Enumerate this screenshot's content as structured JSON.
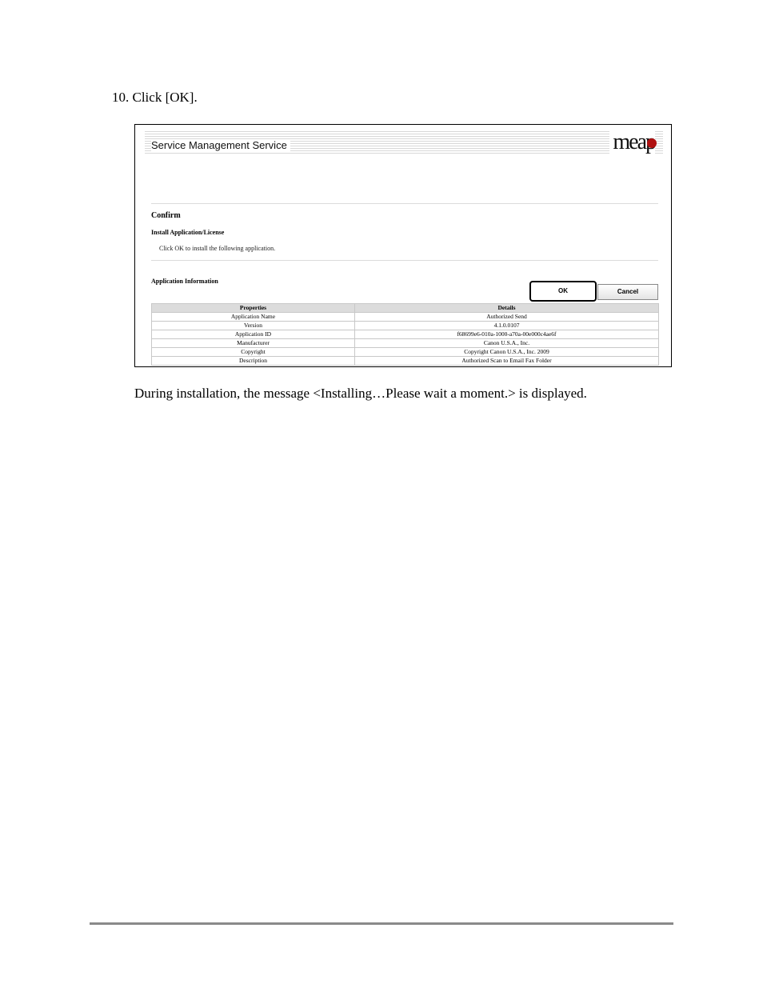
{
  "step": "10. Click [OK].",
  "window": {
    "title": "Service Management Service",
    "logo": "meap",
    "section_title": "Confirm",
    "subsection_title": "Install Application/License",
    "instruction": "Click OK to install the following application.",
    "info_title": "Application Information",
    "ok_label": "OK",
    "cancel_label": "Cancel",
    "table": {
      "headers": [
        "Properties",
        "Details"
      ],
      "rows": [
        [
          "Application Name",
          "Authorized Send"
        ],
        [
          "Version",
          "4.1.0.0107"
        ],
        [
          "Application ID",
          "f68699e6-010a-1000-a70a-00e000c4ae6f"
        ],
        [
          "Manufacturer",
          "Canon U.S.A., Inc."
        ],
        [
          "Copyright",
          "Copyright Canon U.S.A., Inc. 2009"
        ],
        [
          "Description",
          "Authorized Scan to Email Fax Folder"
        ]
      ]
    }
  },
  "note": "During installation, the message <Installing…Please wait a moment.> is displayed."
}
